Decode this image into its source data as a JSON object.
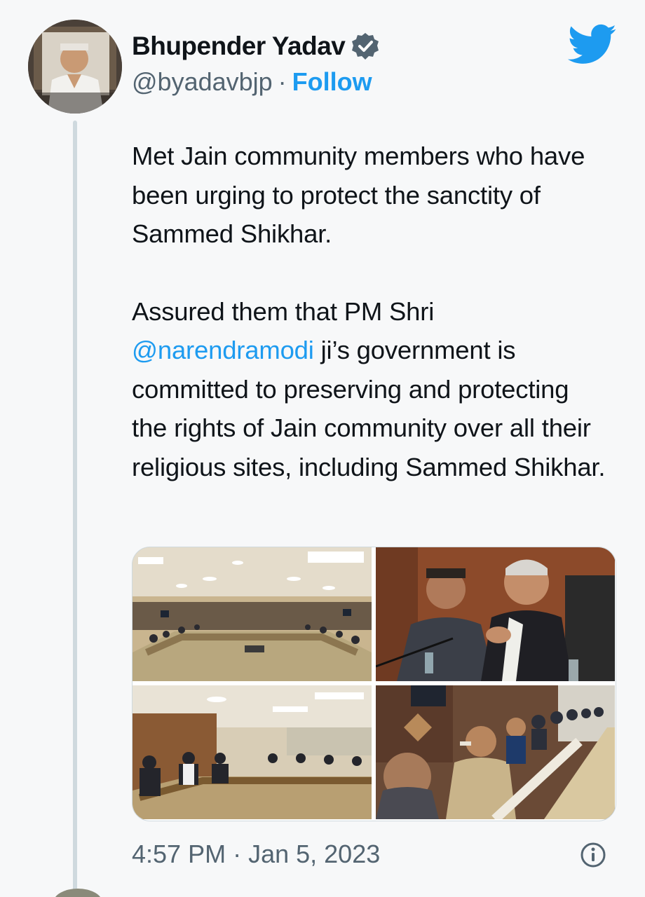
{
  "author": {
    "display_name": "Bhupender Yadav",
    "handle": "@byadavbjp",
    "separator": "·",
    "follow_label": "Follow"
  },
  "tweet": {
    "paragraph1": "Met Jain community members who have been urging to protect the sanctity of Sammed Shikhar.",
    "paragraph2_before": "Assured them that PM Shri ",
    "mention": "@narendramodi",
    "paragraph2_after": " ji’s government is committed to preserving and protecting the rights of Jain community over all their religious sites, including Sammed Shikhar."
  },
  "media": {
    "photos": [
      "photo-1",
      "photo-2",
      "photo-3",
      "photo-4"
    ]
  },
  "meta": {
    "time": "4:57 PM",
    "separator": "·",
    "date": "Jan 5, 2023"
  },
  "icons": {
    "brand": "twitter-bird-icon",
    "verified": "verified-badge-icon",
    "info": "info-icon"
  },
  "colors": {
    "accent": "#1d9bf0",
    "secondary_text": "#536471",
    "text": "#0f1419"
  }
}
